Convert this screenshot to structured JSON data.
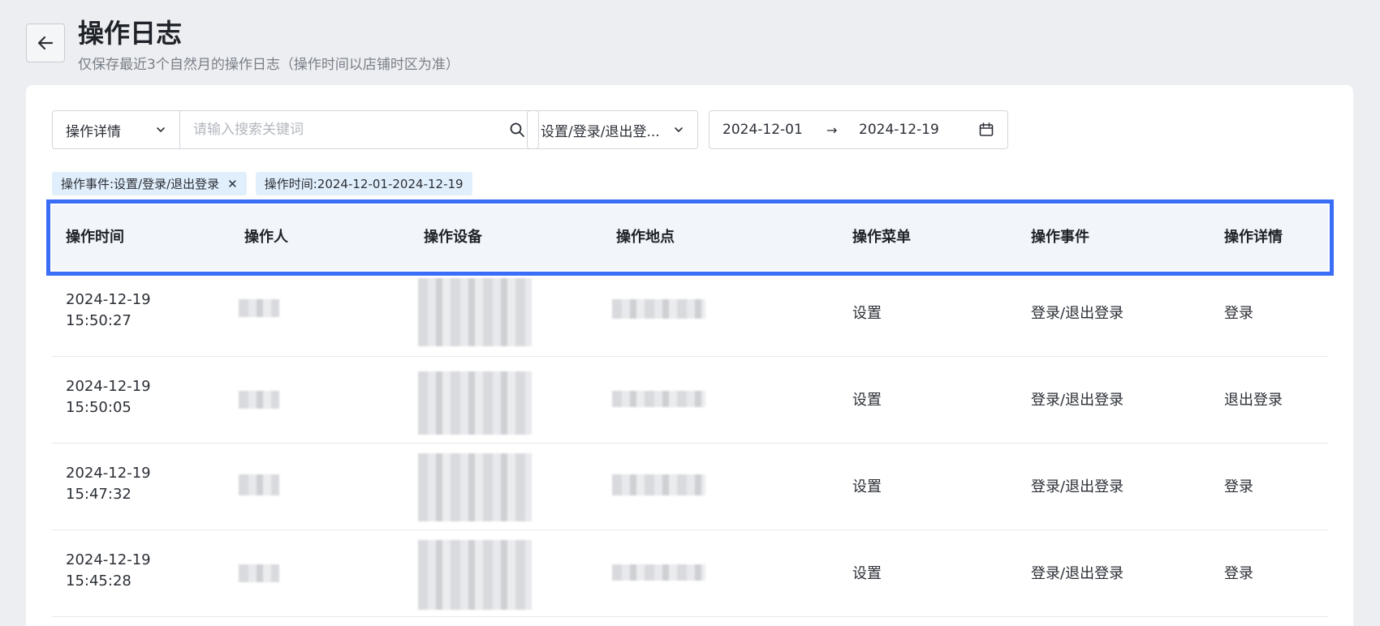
{
  "header": {
    "title": "操作日志",
    "subtitle": "仅保存最近3个自然月的操作日志（操作时间以店铺时区为准）"
  },
  "filters": {
    "search_field": "操作详情",
    "search_placeholder": "请输入搜索关键词",
    "event_select": "设置/登录/退出登...",
    "date_start": "2024-12-01",
    "date_arrow": "→",
    "date_end": "2024-12-19"
  },
  "tags": [
    {
      "label": "操作事件:设置/登录/退出登录",
      "closable": true
    },
    {
      "label": "操作时间:2024-12-01-2024-12-19",
      "closable": false
    }
  ],
  "table": {
    "columns": [
      "操作时间",
      "操作人",
      "操作设备",
      "操作地点",
      "操作菜单",
      "操作事件",
      "操作详情"
    ],
    "rows": [
      {
        "date": "2024-12-19",
        "time": "15:50:27",
        "menu": "设置",
        "event": "登录/退出登录",
        "detail": "登录"
      },
      {
        "date": "2024-12-19",
        "time": "15:50:05",
        "menu": "设置",
        "event": "登录/退出登录",
        "detail": "退出登录"
      },
      {
        "date": "2024-12-19",
        "time": "15:47:32",
        "menu": "设置",
        "event": "登录/退出登录",
        "detail": "登录"
      },
      {
        "date": "2024-12-19",
        "time": "15:45:28",
        "menu": "设置",
        "event": "登录/退出登录",
        "detail": "登录"
      }
    ]
  },
  "colors": {
    "highlight": "#3a6ef6",
    "tag_bg": "#e1effc",
    "header_bg": "#f2f5f9"
  },
  "icons": [
    "back-arrow-icon",
    "chevron-down-icon",
    "search-icon",
    "calendar-icon",
    "close-icon"
  ]
}
